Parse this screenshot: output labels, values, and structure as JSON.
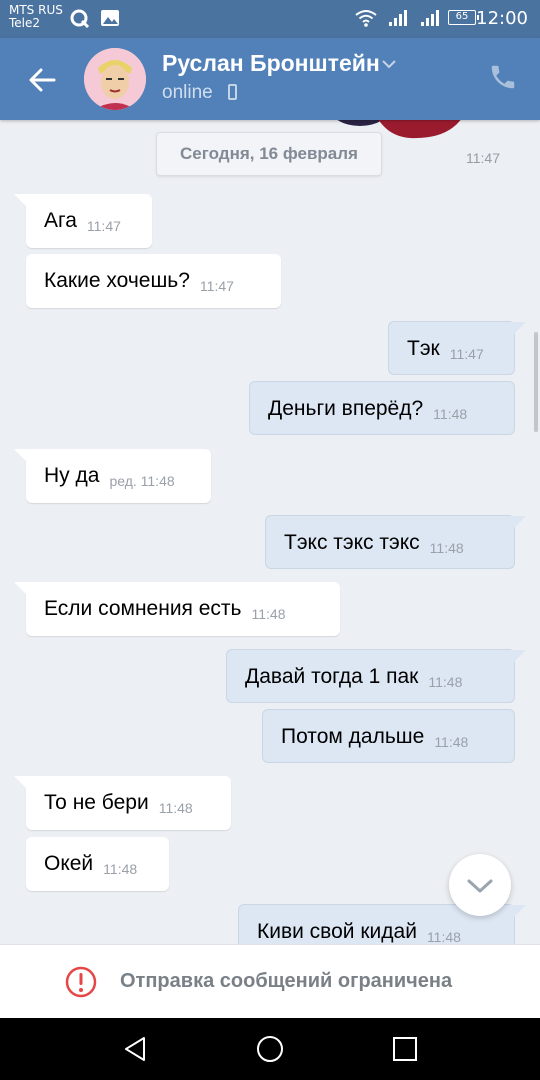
{
  "status": {
    "carrier1": "MTS RUS",
    "carrier2": "Tele2",
    "battery": "65",
    "time": "12:00"
  },
  "header": {
    "name": "Руслан Бронштейн",
    "presence": "online"
  },
  "chat": {
    "date": "Сегодня, 16 февраля",
    "sticker_time": "11:47",
    "messages": [
      {
        "text": "Ага",
        "time": "11:47"
      },
      {
        "text": "Какие хочешь?",
        "time": "11:47"
      },
      {
        "text": "Тэк",
        "time": "11:47"
      },
      {
        "text": "Деньги вперёд?",
        "time": "11:48"
      },
      {
        "text": "Ну да",
        "time": "ред. 11:48"
      },
      {
        "text": "Тэкс тэкс тэкс",
        "time": "11:48"
      },
      {
        "text": "Если сомнения есть",
        "time": "11:48"
      },
      {
        "text": "Давай тогда 1 пак",
        "time": "11:48"
      },
      {
        "text": "Потом дальше",
        "time": "11:48"
      },
      {
        "text": "То не бери",
        "time": "11:48"
      },
      {
        "text": "Окей",
        "time": "11:48"
      },
      {
        "text": "Киви свой кидай",
        "time": "11:48"
      }
    ]
  },
  "footer": {
    "restricted": "Отправка сообщений ограничена"
  },
  "colors": {
    "header": "#5181b8",
    "statusbar": "#4b73a0",
    "incoming": "#ffffff",
    "outgoing": "#dde7f4",
    "background": "#eceff3",
    "warning": "#e64646"
  },
  "icons": [
    "back-arrow-icon",
    "chevron-down-icon",
    "mobile-icon",
    "phone-icon",
    "scroll-down-icon",
    "warning-icon",
    "nav-back-icon",
    "nav-home-icon",
    "nav-recents-icon"
  ]
}
